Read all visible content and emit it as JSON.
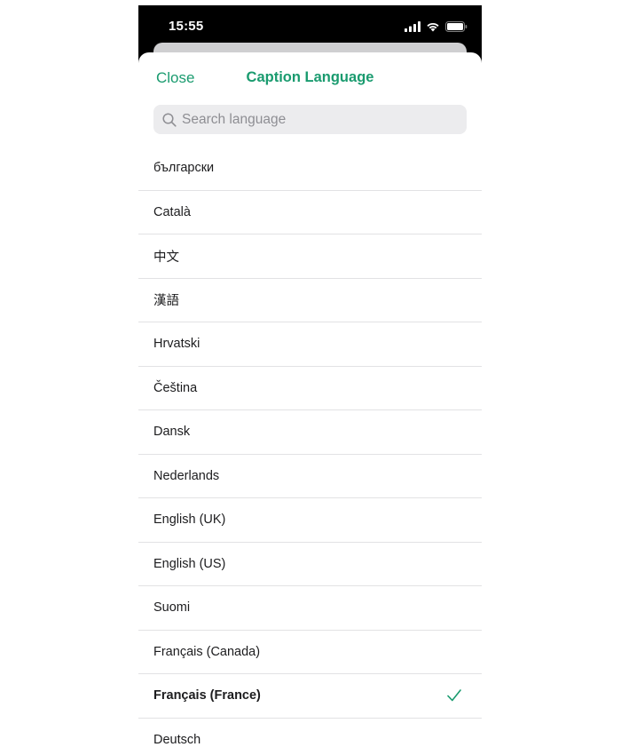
{
  "status_bar": {
    "time": "15:55"
  },
  "header": {
    "close_label": "Close",
    "title": "Caption Language"
  },
  "search": {
    "placeholder": "Search language",
    "value": ""
  },
  "languages": [
    {
      "label": "български",
      "selected": false
    },
    {
      "label": "Català",
      "selected": false
    },
    {
      "label": "中文",
      "selected": false
    },
    {
      "label": "漢語",
      "selected": false
    },
    {
      "label": "Hrvatski",
      "selected": false
    },
    {
      "label": "Čeština",
      "selected": false
    },
    {
      "label": "Dansk",
      "selected": false
    },
    {
      "label": "Nederlands",
      "selected": false
    },
    {
      "label": "English (UK)",
      "selected": false
    },
    {
      "label": "English (US)",
      "selected": false
    },
    {
      "label": "Suomi",
      "selected": false
    },
    {
      "label": "Français (Canada)",
      "selected": false
    },
    {
      "label": "Français (France)",
      "selected": true
    },
    {
      "label": "Deutsch",
      "selected": false
    }
  ],
  "colors": {
    "accent": "#1a9b6f",
    "separator": "#e2e2e4",
    "search_bg": "#ececee"
  },
  "icons": {
    "signal": "cellular-signal-icon",
    "wifi": "wifi-icon",
    "battery": "battery-icon",
    "search": "search-icon",
    "check": "checkmark-icon"
  }
}
